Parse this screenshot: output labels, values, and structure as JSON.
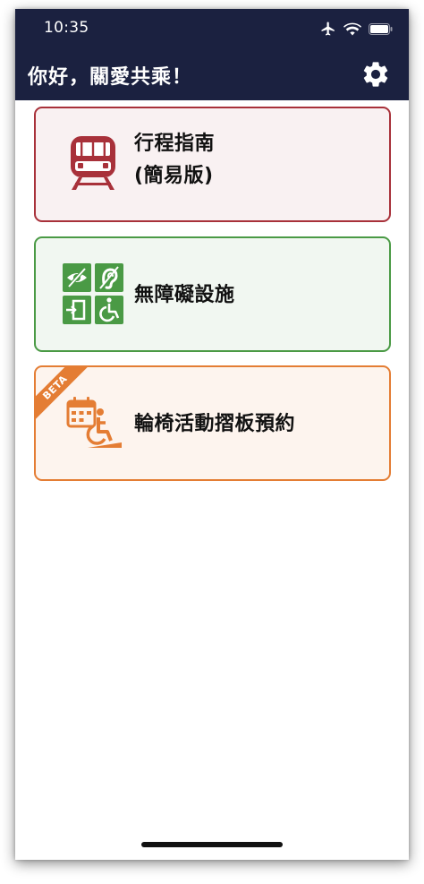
{
  "status": {
    "time": "10:35"
  },
  "header": {
    "title": "你好，關愛共乘！"
  },
  "cards": [
    {
      "lines": [
        "行程指南",
        "(簡易版)"
      ]
    },
    {
      "lines": [
        "無障礙設施"
      ]
    },
    {
      "lines": [
        "輪椅活動摺板預約"
      ],
      "badge": "BETA"
    }
  ],
  "colors": {
    "header_bg": "#1b2140",
    "card_red": "#a8313a",
    "card_green": "#4a9a45",
    "card_orange": "#e47d34"
  },
  "icons": {
    "status": [
      "airplane-icon",
      "wifi-icon",
      "battery-icon"
    ],
    "header": "gear-icon",
    "cards": [
      "train-icon",
      "accessibility-icons",
      "wheelchair-calendar-icon"
    ]
  }
}
